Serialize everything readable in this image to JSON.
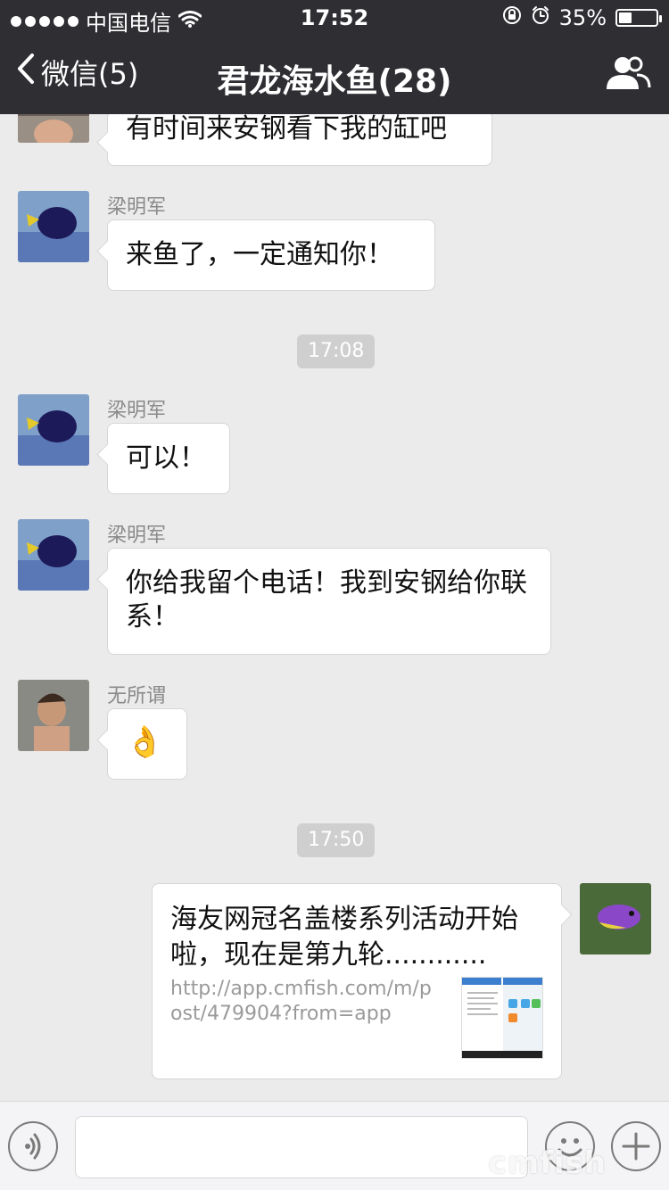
{
  "status_bar": {
    "carrier": "中国电信",
    "time": "17:52",
    "battery_percent": "35%"
  },
  "navbar": {
    "back_label": "微信(5)",
    "title": "君龙海水鱼(28)"
  },
  "chat": {
    "messages": [
      {
        "text": "有时间来安钢看下我的缸吧"
      },
      {
        "sender": "梁明军",
        "text": "来鱼了，一定通知你！"
      },
      {
        "time": "17:08"
      },
      {
        "sender": "梁明军",
        "text": "可以！"
      },
      {
        "sender": "梁明军",
        "text": "你给我留个电话！我到安钢给你联系！"
      },
      {
        "sender": "无所谓",
        "text": "👌"
      },
      {
        "time": "17:50"
      },
      {
        "link_card": {
          "title": "海友网冠名盖楼系列活动开始啦，现在是第九轮............",
          "url": "http://app.cmfish.com/m/post/479904?from=app"
        }
      }
    ]
  },
  "watermark": "cmfish",
  "colors": {
    "bar": "#2e2e33",
    "chat_bg": "#ebebeb",
    "bubble": "#ffffff"
  },
  "icons": {
    "back": "chevron-left-icon",
    "group": "group-icon",
    "voice": "voice-icon",
    "emoji": "emoji-icon",
    "plus": "plus-icon"
  }
}
